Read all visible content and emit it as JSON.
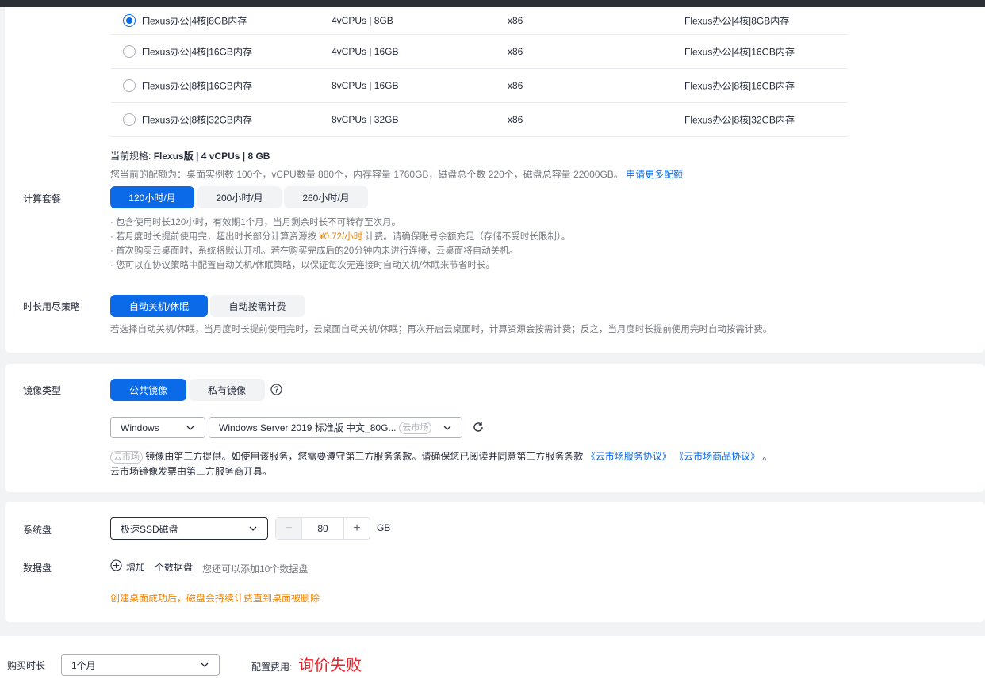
{
  "specs": {
    "rows": [
      {
        "name": "Flexus办公|4核|8GB内存",
        "vcpu_mem": "4vCPUs | 8GB",
        "arch": "x86",
        "desc": "Flexus办公|4核|8GB内存",
        "selected": true
      },
      {
        "name": "Flexus办公|4核|16GB内存",
        "vcpu_mem": "4vCPUs | 16GB",
        "arch": "x86",
        "desc": "Flexus办公|4核|16GB内存",
        "selected": false
      },
      {
        "name": "Flexus办公|8核|16GB内存",
        "vcpu_mem": "8vCPUs | 16GB",
        "arch": "x86",
        "desc": "Flexus办公|8核|16GB内存",
        "selected": false
      },
      {
        "name": "Flexus办公|8核|32GB内存",
        "vcpu_mem": "8vCPUs | 32GB",
        "arch": "x86",
        "desc": "Flexus办公|8核|32GB内存",
        "selected": false
      }
    ],
    "current_label": "当前规格:",
    "current_value": "Flexus版 | 4 vCPUs | 8 GB",
    "quota_text": "您当前的配额为：桌面实例数 100个，vCPU数量 880个，内存容量 1760GB，磁盘总个数 220个，磁盘总容量 22000GB。",
    "quota_link": "申请更多配额"
  },
  "compute_package": {
    "label": "计算套餐",
    "options": [
      "120小时/月",
      "200小时/月",
      "260小时/月"
    ],
    "notes": {
      "n1": "· 包含使用时长120小时，有效期1个月，当月剩余时长不可转存至次月。",
      "n2_prefix": "· 若月度时长提前使用完，超出时长部分计算资源按",
      "n2_price": "¥0.72/小时",
      "n2_suffix": "计费。请确保账号余额充足（存储不受时长限制）。",
      "n3": "· 首次购买云桌面时，系统将默认开机。若在购买完成后的20分钟内未进行连接，云桌面将自动关机。",
      "n4": "· 您可以在协议策略中配置自动关机/休眠策略，以保证每次无连接时自动关机/休眠来节省时长。"
    }
  },
  "exhaust_policy": {
    "label": "时长用尽策略",
    "options": [
      "自动关机/休眠",
      "自动按需计费"
    ],
    "note": "若选择自动关机/休眠，当月度时长提前使用完时，云桌面自动关机/休眠；再次开启云桌面时，计算资源会按需计费；反之，当月度时长提前使用完时自动按需计费。"
  },
  "image": {
    "label": "镜像类型",
    "options": [
      "公共镜像",
      "私有镜像"
    ],
    "os_select": "Windows",
    "image_select": "Windows Server 2019 标准版 中文_80G...",
    "market_tag": "云市场",
    "notice_text": "镜像由第三方提供。如使用该服务，您需要遵守第三方服务条款。请确保您已阅读并同意第三方服务条款",
    "agreement1": "《云市场服务协议》",
    "agreement2": "《云市场商品协议》",
    "notice_end": "。",
    "invoice_note": "云市场镜像发票由第三方服务商开具。"
  },
  "disk": {
    "system_label": "系统盘",
    "system_type": "极速SSD磁盘",
    "system_size": "80",
    "unit": "GB",
    "data_label": "数据盘",
    "add_label": "增加一个数据盘",
    "add_hint": "您还可以添加10个数据盘",
    "warning": "创建桌面成功后，磁盘会持续计费直到桌面被删除"
  },
  "footer": {
    "duration_label": "购买时长",
    "duration_value": "1个月",
    "fee_label": "配置费用:",
    "fee_value": "询价失败"
  },
  "colors": {
    "primary": "#0a6ae8",
    "warning": "#f28200",
    "error": "#e6212a"
  }
}
